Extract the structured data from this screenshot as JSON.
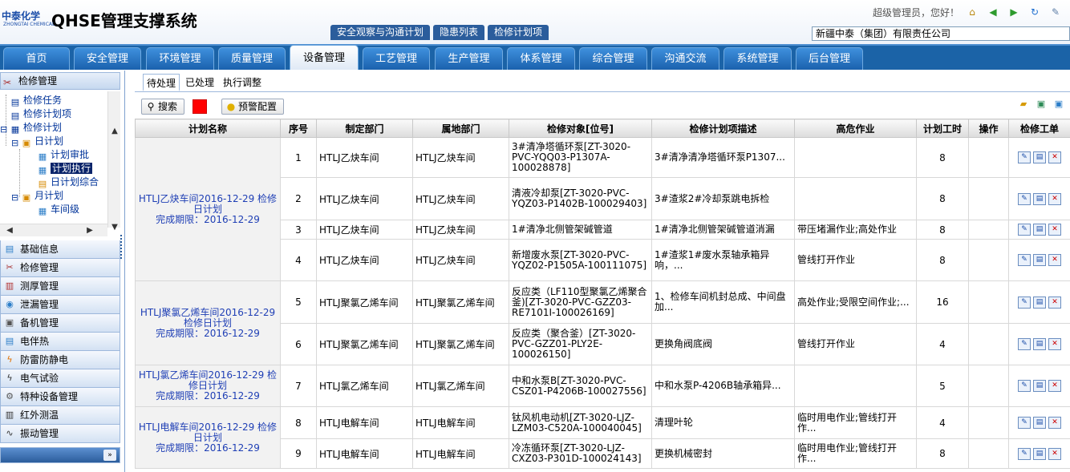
{
  "header": {
    "logo_cn": "中泰化学",
    "logo_en": "ZHONGTAI CHEMICAL",
    "title": "QHSE管理支撑系统",
    "user_greeting": "超级管理员，您好！",
    "top_icons": [
      "home-icon",
      "back-icon",
      "forward-icon",
      "refresh-icon",
      "tools-icon"
    ],
    "sub_tabs": [
      "安全观察与沟通计划",
      "隐患列表",
      "检修计划项"
    ],
    "company": "新疆中泰（集团）有限责任公司"
  },
  "nav": {
    "tabs": [
      "首页",
      "安全管理",
      "环境管理",
      "质量管理",
      "设备管理",
      "工艺管理",
      "生产管理",
      "体系管理",
      "综合管理",
      "沟通交流",
      "系统管理",
      "后台管理"
    ],
    "active": "设备管理"
  },
  "sidebar": {
    "title": "检修管理",
    "tree": [
      "检修任务",
      "检修计划项",
      "检修计划",
      "日计划",
      "计划审批",
      "计划执行",
      "日计划综合",
      "月计划",
      "车间级"
    ],
    "selected": "计划执行",
    "accordion": [
      "基础信息",
      "检修管理",
      "测厚管理",
      "泄漏管理",
      "备机管理",
      "电伴热",
      "防雷防静电",
      "电气试验",
      "特种设备管理",
      "红外测温",
      "振动管理"
    ]
  },
  "content": {
    "tabs": [
      "待处理",
      "已处理",
      "执行调整"
    ],
    "active_tab": "待处理",
    "toolbar": {
      "search": "搜索",
      "alert_config": "预警配置"
    },
    "right_tools": [
      "folder-open-icon",
      "import-icon",
      "export-icon"
    ]
  },
  "table": {
    "columns": [
      "计划名称",
      "序号",
      "制定部门",
      "属地部门",
      "检修对象[位号]",
      "检修计划项描述",
      "高危作业",
      "计划工时",
      "操作",
      "检修工单"
    ],
    "groups": [
      {
        "plan_name": "HTLJ乙炔车间2016-12-29 检修日计划",
        "deadline": "完成期限：2016-12-29",
        "rows": [
          {
            "seq": "1",
            "dept": "HTLJ乙炔车间",
            "local": "HTLJ乙炔车间",
            "obj": "3#清净塔循环泵[ZT-3020-PVC-YQQ03-P1307A-100028878]",
            "desc": "3#清净清净塔循环泵P1307...",
            "risk": "",
            "hours": "8"
          },
          {
            "seq": "2",
            "dept": "HTLJ乙炔车间",
            "local": "HTLJ乙炔车间",
            "obj": "清液冷却泵[ZT-3020-PVC-YQZ03-P1402B-100029403]",
            "desc": "3#渣浆2#冷却泵跳电拆检",
            "risk": "",
            "hours": "8"
          },
          {
            "seq": "3",
            "dept": "HTLJ乙炔车间",
            "local": "HTLJ乙炔车间",
            "obj": "1#清净北侧管架碱管道",
            "desc": "1#清净北侧管架碱管道消漏",
            "risk": "带压堵漏作业;高处作业",
            "hours": "8"
          },
          {
            "seq": "4",
            "dept": "HTLJ乙炔车间",
            "local": "HTLJ乙炔车间",
            "obj": "新增废水泵[ZT-3020-PVC-YQZ02-P1505A-100111075]",
            "desc": "1#渣浆1#废水泵轴承箱异响，...",
            "risk": "管线打开作业",
            "hours": "8"
          }
        ]
      },
      {
        "plan_name": "HTLJ聚氯乙烯车间2016-12-29 检修日计划",
        "deadline": "完成期限：2016-12-29",
        "rows": [
          {
            "seq": "5",
            "dept": "HTLJ聚氯乙烯车间",
            "local": "HTLJ聚氯乙烯车间",
            "obj": "反应类（LF110型聚氯乙烯聚合釜)[ZT-3020-PVC-GZZ03-RE7101I-100026169]",
            "desc": "1、检修车间机封总成、中间盘加...",
            "risk": "高处作业;受限空间作业;...",
            "hours": "16"
          },
          {
            "seq": "6",
            "dept": "HTLJ聚氯乙烯车间",
            "local": "HTLJ聚氯乙烯车间",
            "obj": "反应类（聚合釜）[ZT-3020-PVC-GZZ01-PLY2E-100026150]",
            "desc": "更换角阀底阀",
            "risk": "管线打开作业",
            "hours": "4"
          }
        ]
      },
      {
        "plan_name": "HTLJ氯乙烯车间2016-12-29 检修日计划",
        "deadline": "完成期限：2016-12-29",
        "rows": [
          {
            "seq": "7",
            "dept": "HTLJ氯乙烯车间",
            "local": "HTLJ氯乙烯车间",
            "obj": "中和水泵B[ZT-3020-PVC-CSZ01-P4206B-100027556]",
            "desc": "中和水泵P-4206B轴承箱异...",
            "risk": "",
            "hours": "5"
          }
        ]
      },
      {
        "plan_name": "HTLJ电解车间2016-12-29 检修日计划",
        "deadline": "完成期限：2016-12-29",
        "rows": [
          {
            "seq": "8",
            "dept": "HTLJ电解车间",
            "local": "HTLJ电解车间",
            "obj": "钛风机电动机[ZT-3020-LJZ-LZM03-C520A-100040045]",
            "desc": "清理叶轮",
            "risk": "临时用电作业;管线打开作...",
            "hours": "4"
          },
          {
            "seq": "9",
            "dept": "HTLJ电解车间",
            "local": "HTLJ电解车间",
            "obj": "冷冻循环泵[ZT-3020-LJZ-CXZ03-P301D-100024143]",
            "desc": "更换机械密封",
            "risk": "临时用电作业;管线打开作...",
            "hours": "8"
          }
        ]
      }
    ]
  }
}
